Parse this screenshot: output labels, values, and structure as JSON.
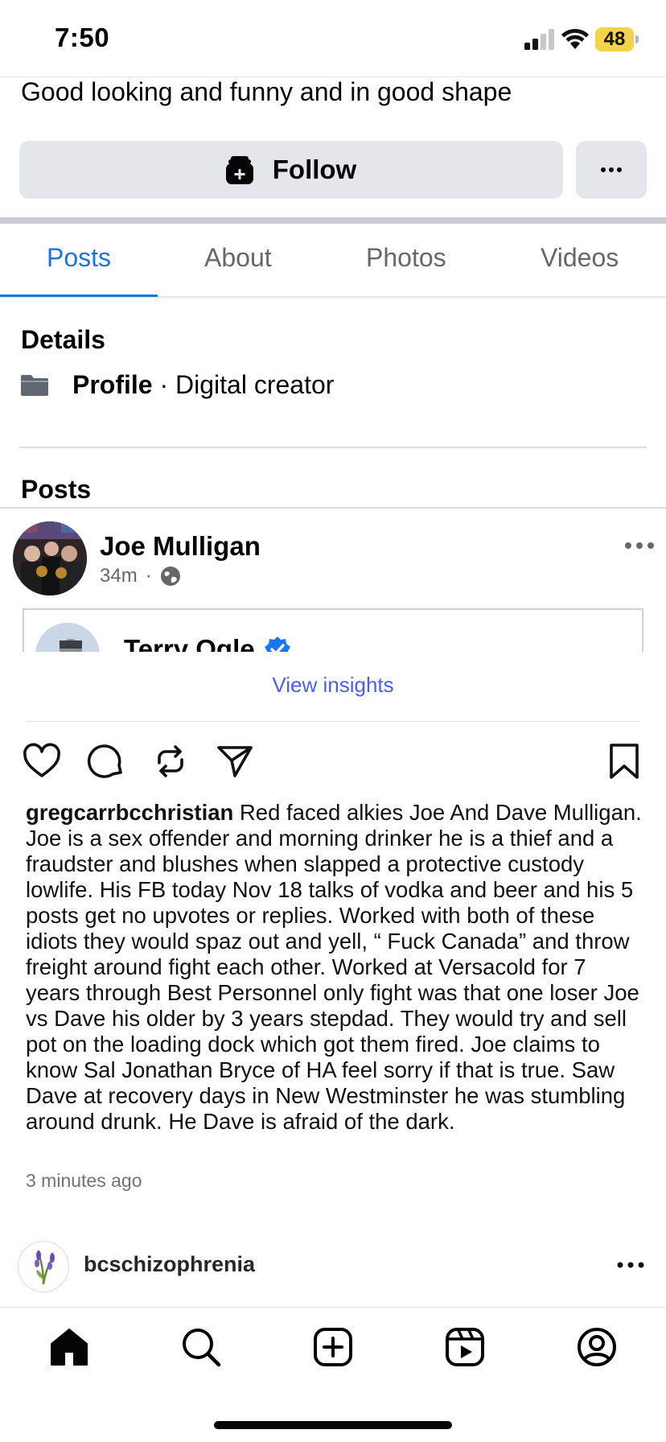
{
  "status_bar": {
    "time": "7:50",
    "battery": "48"
  },
  "profile": {
    "bio": "Good looking and funny and in good shape",
    "follow_label": "Follow",
    "details_title": "Details",
    "category_bold": "Profile",
    "category_rest": " · Digital creator",
    "posts_title": "Posts"
  },
  "tabs": [
    {
      "label": "Posts",
      "active": true
    },
    {
      "label": "About",
      "active": false
    },
    {
      "label": "Photos",
      "active": false
    },
    {
      "label": "Videos",
      "active": false
    }
  ],
  "post": {
    "author": "Joe Mulligan",
    "time": "34m",
    "separator": "·",
    "shared_author": "Terry Ogle"
  },
  "instagram": {
    "view_insights": "View insights",
    "caption_user": "gregcarrbcchristian",
    "caption_text": " Red faced alkies Joe And Dave Mulligan. Joe is a sex offender and morning drinker he is a thief and a fraudster and blushes when slapped a protective custody lowlife. His FB today Nov 18 talks of vodka and beer and his 5 posts get no upvotes or replies. Worked with both of these idiots they would spaz out and yell, “ Fuck Canada” and throw freight around fight each other. Worked at Versacold for 7 years through Best Personnel only fight was that one loser Joe vs Dave his older by 3 years stepdad. They would try and sell pot on the loading dock which got them fired. Joe claims to know Sal Jonathan Bryce of HA feel sorry if that is true. Saw Dave at recovery days in New Westminster he was stumbling around drunk. He Dave is afraid of the dark.",
    "timestamp": "3 minutes ago",
    "next_user": "bcschizophrenia"
  },
  "colors": {
    "facebook_blue": "#1b74e4",
    "insights_link": "#4a5df9",
    "button_gray": "#e4e6eb",
    "battery_yellow": "#f3d34a",
    "verified_blue": "#1877f2"
  },
  "icons": {
    "follow": "follow-icon",
    "category": "folder-icon",
    "privacy": "globe-icon",
    "actions": [
      "heart-icon",
      "comment-icon",
      "repost-icon",
      "send-icon",
      "bookmark-icon"
    ],
    "nav": [
      "home-icon",
      "search-icon",
      "create-icon",
      "reels-icon",
      "profile-icon"
    ]
  }
}
